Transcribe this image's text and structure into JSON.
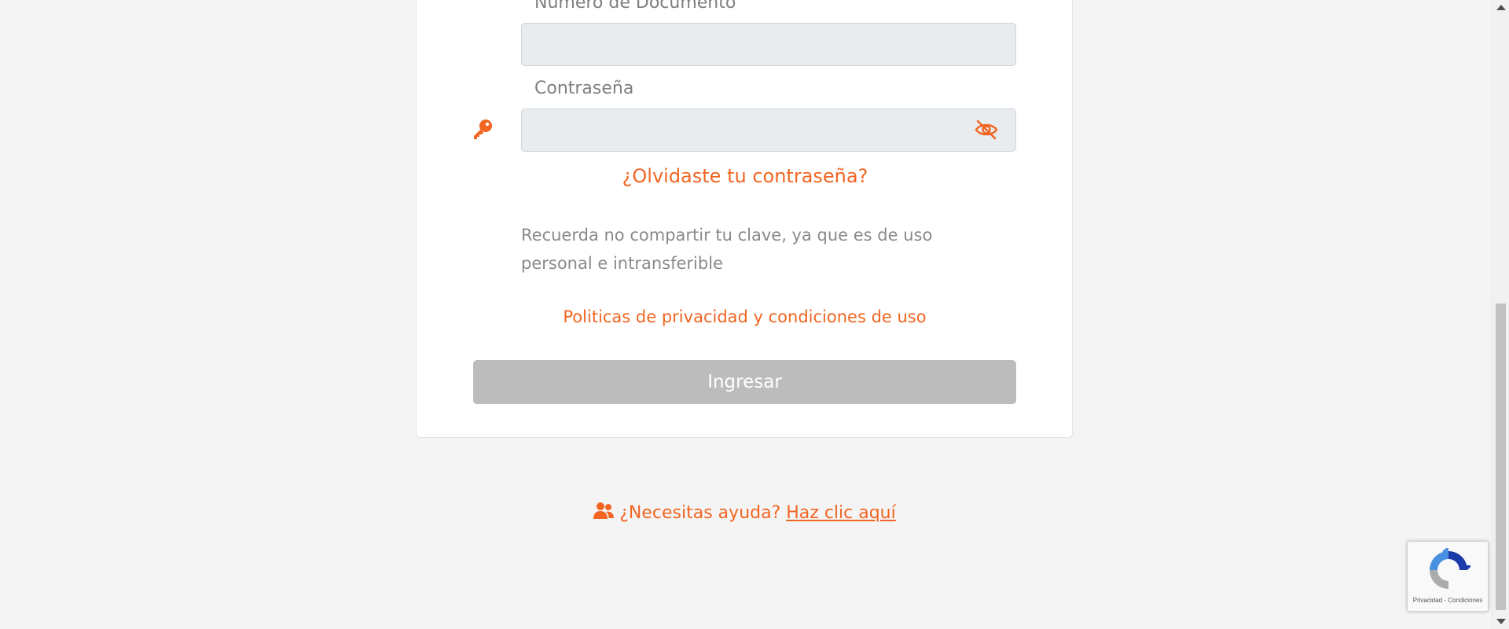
{
  "colors": {
    "accent": "#f26522",
    "page_bg": "#f4f4f4",
    "input_bg": "#e9ecef",
    "button_disabled": "#bcbcbc",
    "muted_text": "#8a8a8a"
  },
  "form": {
    "document_label": "Número de Documento",
    "document_value": "",
    "password_label": "Contraseña",
    "password_value": "",
    "password_icon": "key-icon",
    "toggle_icon": "eye-slash-icon",
    "forgot_link": "¿Olvidaste tu contraseña?",
    "notice": "Recuerda no compartir tu clave, ya que es de uso personal e intransferible",
    "privacy_link": "Politicas de privacidad y condiciones de uso",
    "submit_label": "Ingresar"
  },
  "help": {
    "icon": "users-icon",
    "question": "¿Necesitas ayuda?",
    "link": "Haz clic aquí"
  },
  "recaptcha": {
    "icon": "recaptcha-logo-icon",
    "links": "Privacidad - Condiciones"
  }
}
